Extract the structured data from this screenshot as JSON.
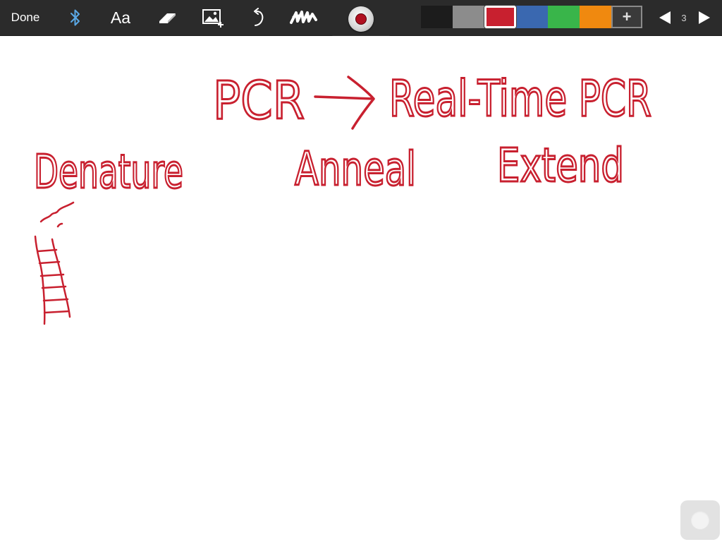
{
  "toolbar": {
    "done_label": "Done",
    "text_tool_label": "Aa",
    "page_number": "3",
    "icons": {
      "bluetooth": "bluetooth-icon",
      "eraser": "eraser-icon",
      "image": "add-image-icon",
      "undo": "undo-icon",
      "pen": "pen-stroke-icon",
      "record": "record-icon",
      "prev": "triangle-left-icon",
      "next": "triangle-right-icon"
    },
    "colors": [
      "#1c1c1c",
      "#8c8c8c",
      "#c8202f",
      "#3a68b0",
      "#39b54a",
      "#f0890f"
    ],
    "selected_color": "#c8202f",
    "add_color_label": "+"
  },
  "canvas": {
    "ink_color": "#c8202f",
    "handwriting": {
      "title_left": "PCR",
      "title_right": "Real-Time PCR",
      "step_1": "Denature",
      "step_2": "Anneal",
      "step_3": "Extend"
    }
  }
}
